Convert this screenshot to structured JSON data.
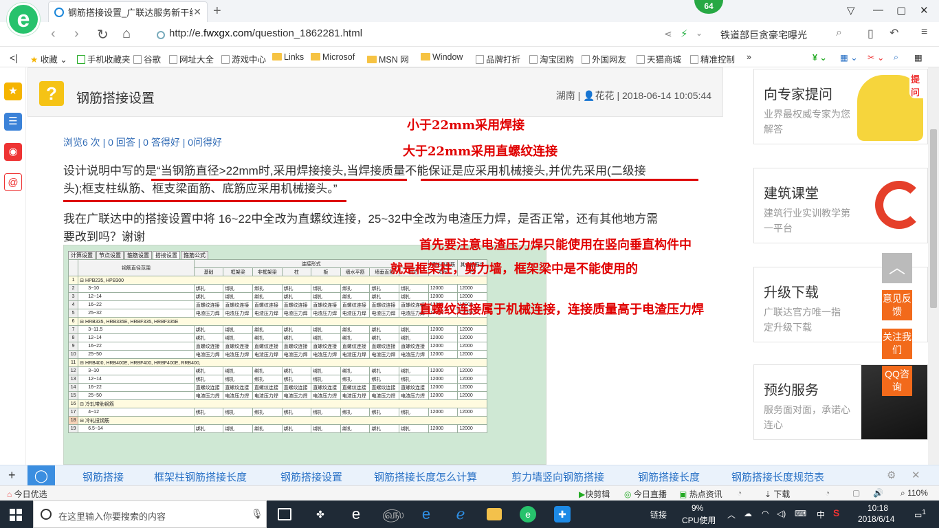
{
  "browser": {
    "tab_title": "钢筋搭接设置_广联达服务新干线",
    "badge_count": "64",
    "url_prefix": "http://e.",
    "url_host": "fwxgx.com",
    "url_path": "/question_1862281.html",
    "search_hint": "铁道部巨贪豪宅曝光"
  },
  "bookmarks": [
    "收藏",
    "手机收藏夹",
    "谷歌",
    "网址大全",
    "游戏中心",
    "Links",
    "Microsof",
    "MSN 网",
    "Window",
    "品牌打折",
    "淘宝团购",
    "外国网友",
    "天猫商城",
    "精准控制"
  ],
  "question": {
    "title": "钢筋搭接设置",
    "meta": "湖南 | 👤花花 | 2018-06-14 10:05:44",
    "stats": "浏览6 次 | 0 回答 | 0 答得好 | 0问得好",
    "p1_line1": "设计说明中写的是“当钢筋直径>22mm时,采用焊接接头,当焊接质量不能保证是应采用机械接头,并优先采用(二级接",
    "p1_line2": "头);框支柱纵筋、框支梁面筋、底筋应采用机械接头。”",
    "p2_line1": "我在广联达中的搭接设置中将 16~22中全改为直螺纹连接，25~32中全改为电渣压力焊，是否正常，还有其他地方需",
    "p2_line2": "要改到吗？谢谢"
  },
  "annotations": {
    "a1": "小于22mm采用焊接",
    "a2": "大于22mm采用直螺纹连接",
    "a3": "首先要注意电渣压力焊只能使用在竖向垂直构件中",
    "a4": "就是框架柱，剪力墙，框架梁中是不能使用的",
    "a5": "直螺纹连接属于机械连接，连接质量高于电渣压力焊"
  },
  "embedded": {
    "tabs": [
      "计算设置",
      "节点设置",
      "箍筋设置",
      "搭接设置",
      "箍筋公式"
    ],
    "active_tab": "搭接设置",
    "header_group": "连接形式",
    "col_range": "钢筋直径范围",
    "cols": [
      "基础",
      "框架梁",
      "非框架梁",
      "柱",
      "板",
      "墙水平筋",
      "墙垂直筋",
      "其它",
      "墙柱垂直筋定尺",
      "其余钢筋定尺"
    ],
    "rows": [
      {
        "n": "1",
        "label": "⊟ HPB235, HPB300",
        "group": true
      },
      {
        "n": "2",
        "label": "3~10",
        "vals": [
          "绑扎",
          "绑扎",
          "绑扎",
          "绑扎",
          "绑扎",
          "绑扎",
          "绑扎",
          "绑扎",
          "12000",
          "12000"
        ]
      },
      {
        "n": "3",
        "label": "12~14",
        "vals": [
          "绑扎",
          "绑扎",
          "绑扎",
          "绑扎",
          "绑扎",
          "绑扎",
          "绑扎",
          "绑扎",
          "12000",
          "12000"
        ]
      },
      {
        "n": "4",
        "label": "16~22",
        "vals": [
          "直螺纹连接",
          "直螺纹连接",
          "直螺纹连接",
          "直螺纹连接",
          "直螺纹连接",
          "直螺纹连接",
          "直螺纹连接",
          "直螺纹连接",
          "12000",
          "12000"
        ]
      },
      {
        "n": "5",
        "label": "25~32",
        "vals": [
          "电渣压力焊",
          "电渣压力焊",
          "电渣压力焊",
          "电渣压力焊",
          "电渣压力焊",
          "电渣压力焊",
          "电渣压力焊",
          "电渣压力焊",
          "12000",
          "12000"
        ]
      },
      {
        "n": "6",
        "label": "⊟ HRB335, HRB335E, HRBF335, HRBF335E",
        "group": true
      },
      {
        "n": "7",
        "label": "3~11.5",
        "vals": [
          "绑扎",
          "绑扎",
          "绑扎",
          "绑扎",
          "绑扎",
          "绑扎",
          "绑扎",
          "绑扎",
          "12000",
          "12000"
        ]
      },
      {
        "n": "8",
        "label": "12~14",
        "vals": [
          "绑扎",
          "绑扎",
          "绑扎",
          "绑扎",
          "绑扎",
          "绑扎",
          "绑扎",
          "绑扎",
          "12000",
          "12000"
        ]
      },
      {
        "n": "9",
        "label": "16~22",
        "vals": [
          "直螺纹连接",
          "直螺纹连接",
          "直螺纹连接",
          "直螺纹连接",
          "直螺纹连接",
          "直螺纹连接",
          "直螺纹连接",
          "直螺纹连接",
          "12000",
          "12000"
        ]
      },
      {
        "n": "10",
        "label": "25~50",
        "vals": [
          "电渣压力焊",
          "电渣压力焊",
          "电渣压力焊",
          "电渣压力焊",
          "电渣压力焊",
          "电渣压力焊",
          "电渣压力焊",
          "电渣压力焊",
          "12000",
          "12000"
        ]
      },
      {
        "n": "11",
        "label": "⊟ HRB400, HRB400E, HRBF400, HRBF400E, RRB400,",
        "group": true
      },
      {
        "n": "12",
        "label": "3~10",
        "vals": [
          "绑扎",
          "绑扎",
          "绑扎",
          "绑扎",
          "绑扎",
          "绑扎",
          "绑扎",
          "绑扎",
          "12000",
          "12000"
        ]
      },
      {
        "n": "13",
        "label": "12~14",
        "vals": [
          "绑扎",
          "绑扎",
          "绑扎",
          "绑扎",
          "绑扎",
          "绑扎",
          "绑扎",
          "绑扎",
          "12000",
          "12000"
        ]
      },
      {
        "n": "14",
        "label": "16~22",
        "vals": [
          "直螺纹连接",
          "直螺纹连接",
          "直螺纹连接",
          "直螺纹连接",
          "直螺纹连接",
          "直螺纹连接",
          "直螺纹连接",
          "直螺纹连接",
          "12000",
          "12000"
        ]
      },
      {
        "n": "15",
        "label": "25~50",
        "vals": [
          "电渣压力焊",
          "电渣压力焊",
          "电渣压力焊",
          "电渣压力焊",
          "电渣压力焊",
          "电渣压力焊",
          "电渣压力焊",
          "电渣压力焊",
          "12000",
          "12000"
        ]
      },
      {
        "n": "16",
        "label": "⊟ 冷轧带肋钢筋",
        "group": true
      },
      {
        "n": "17",
        "label": "4~12",
        "vals": [
          "绑扎",
          "绑扎",
          "绑扎",
          "绑扎",
          "绑扎",
          "绑扎",
          "绑扎",
          "绑扎",
          "12000",
          "12000"
        ]
      },
      {
        "n": "18",
        "label": "⊟ 冷轧扭钢筋",
        "group": true
      },
      {
        "n": "19",
        "label": "6.5~14",
        "vals": [
          "绑扎",
          "绑扎",
          "绑扎",
          "绑扎",
          "绑扎",
          "绑扎",
          "绑扎",
          "绑扎",
          "12000",
          "12000"
        ]
      }
    ]
  },
  "sidebar": [
    {
      "title": "向专家提问",
      "sub": "业界最权威专家为您解答",
      "tag": "提问"
    },
    {
      "title": "建筑课堂",
      "sub": "建筑行业实训教学第一平台"
    },
    {
      "title": "升级下载",
      "sub": "广联达官方唯一指定升级下载"
    },
    {
      "title": "预约服务",
      "sub": "服务面对面，承诺心连心"
    }
  ],
  "float_btns": [
    "意见反馈",
    "关注我们",
    "QQ咨询"
  ],
  "tags": [
    "钢筋搭接",
    "框架柱钢筋搭接长度",
    "钢筋搭接设置",
    "钢筋搭接长度怎么计算",
    "剪力墙竖向钢筋搭接",
    "钢筋搭接长度",
    "钢筋搭接长度规范表"
  ],
  "statusbar": {
    "left": "今日优选",
    "items": [
      "快剪辑",
      "今日直播",
      "热点资讯",
      "下载",
      "110%"
    ]
  },
  "taskbar": {
    "search_placeholder": "在这里输入你要搜索的内容",
    "link": "链接",
    "cpu_pct": "9%",
    "cpu_label": "CPU使用",
    "ime": "中",
    "time": "10:18",
    "date": "2018/6/14",
    "notif": "1"
  }
}
